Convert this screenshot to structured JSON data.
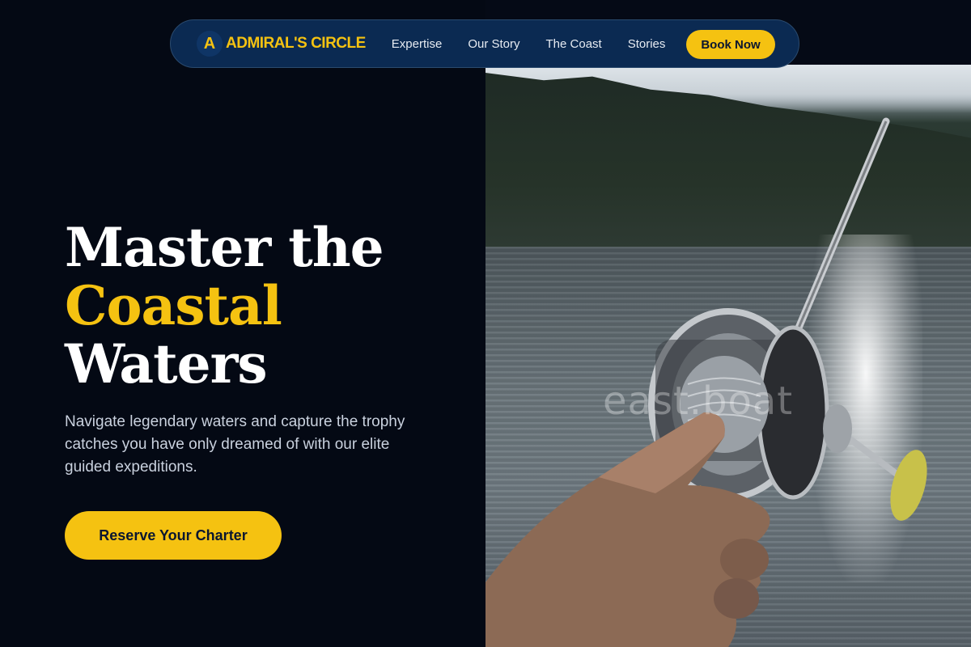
{
  "nav": {
    "brand_mark": "A",
    "brand_name": "ADMIRAL'S CIRCLE",
    "links": [
      "Expertise",
      "Our Story",
      "The Coast",
      "Stories"
    ],
    "cta_label": "Book Now"
  },
  "hero": {
    "title_line1": "Master the",
    "title_line2": "Coastal",
    "title_line3": "Waters",
    "subtitle": "Navigate legendary waters and capture the trophy catches you have only dreamed of with our elite guided expeditions.",
    "cta_label": "Reserve Your Charter"
  },
  "image": {
    "watermark": "east.boat"
  },
  "colors": {
    "accent": "#f5c211",
    "background": "#040914",
    "nav_bg": "#0b2a52"
  }
}
